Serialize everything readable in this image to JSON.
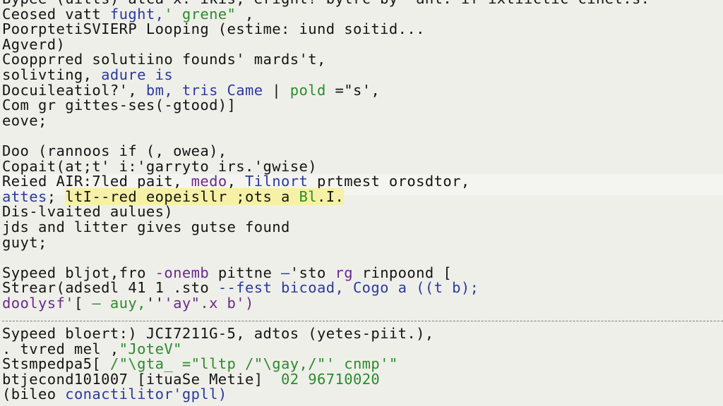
{
  "colors": {
    "text": "#141414",
    "blue": "#2b3a9c",
    "green": "#2a8c2a",
    "purple": "#6a2a8a",
    "highlight": "#f6f1a6"
  },
  "lines": [
    {
      "segs": [
        {
          "t": "Bypee (uitts) atca-x. ikis, eright? bytrc by  ant. if ixtiictic cinet.s.",
          "c": "text"
        }
      ]
    },
    {
      "segs": [
        {
          "t": "Ceosed vatt ",
          "c": "text"
        },
        {
          "t": "fught,",
          "c": "blue"
        },
        {
          "t": "' grene\"",
          "c": "green"
        },
        {
          "t": " ,",
          "c": "text"
        }
      ]
    },
    {
      "segs": [
        {
          "t": "PoorptetiSVIERP Looping (estime: iund soitid...",
          "c": "text"
        }
      ]
    },
    {
      "segs": [
        {
          "t": "Agverd)",
          "c": "text"
        }
      ]
    },
    {
      "segs": [
        {
          "t": "Coopprred solutiino founds' mards't,",
          "c": "text"
        }
      ]
    },
    {
      "segs": [
        {
          "t": "solivting, ",
          "c": "text"
        },
        {
          "t": "adure is",
          "c": "blue"
        }
      ]
    },
    {
      "segs": [
        {
          "t": "Docuileatiol?', ",
          "c": "text"
        },
        {
          "t": "bm, tris Came",
          "c": "blue"
        },
        {
          "t": " | ",
          "c": "text"
        },
        {
          "t": "pold",
          "c": "green"
        },
        {
          "t": " =\"s',",
          "c": "text"
        }
      ]
    },
    {
      "segs": [
        {
          "t": "Com gr gittes-ses(-gtood)]",
          "c": "text"
        }
      ]
    },
    {
      "segs": [
        {
          "t": "eove;",
          "c": "text"
        }
      ]
    },
    {
      "segs": []
    },
    {
      "segs": [
        {
          "t": "Doo (rannoos if (, owea),",
          "c": "text"
        }
      ]
    },
    {
      "segs": [
        {
          "t": "Copait(at;t' i:'garryto irs.'gwise)",
          "c": "text"
        }
      ]
    },
    {
      "segs": [
        {
          "t": "Reied AIR:7led pait, ",
          "c": "text"
        },
        {
          "t": "medo",
          "c": "purple"
        },
        {
          "t": ", ",
          "c": "text"
        },
        {
          "t": "Tilnort",
          "c": "blue"
        },
        {
          "t": " prtmest orosdtor,",
          "c": "text"
        }
      ]
    },
    {
      "highlight": true,
      "segs": [
        {
          "t": "attes",
          "c": "blue"
        },
        {
          "t": "; ",
          "c": "text"
        },
        {
          "t": "ltI--red eopeisllr ;ots a ",
          "c": "text",
          "hl": true
        },
        {
          "t": "Bl",
          "c": "green",
          "hl": true
        },
        {
          "t": ".I.",
          "c": "text",
          "hl": true
        }
      ]
    },
    {
      "segs": [
        {
          "t": "Dis-lvaited aulues)",
          "c": "text"
        }
      ]
    },
    {
      "segs": [
        {
          "t": "jds and litter gives gutse found",
          "c": "text"
        }
      ]
    },
    {
      "segs": [
        {
          "t": "guyt;",
          "c": "text"
        }
      ]
    },
    {
      "segs": []
    },
    {
      "segs": [
        {
          "t": "Sypeed bljot,fro ",
          "c": "text"
        },
        {
          "t": "-onemb",
          "c": "purple"
        },
        {
          "t": " pittne ",
          "c": "text"
        },
        {
          "t": "—",
          "c": "blue"
        },
        {
          "t": "'sto ",
          "c": "text"
        },
        {
          "t": "rg",
          "c": "purple"
        },
        {
          "t": " rinpoond [",
          "c": "text"
        }
      ]
    },
    {
      "segs": [
        {
          "t": "Strear(adsedl 41 1 .sto ",
          "c": "text"
        },
        {
          "t": "--fest bicoad, Cogo a ((t b);",
          "c": "blue"
        }
      ]
    },
    {
      "segs": [
        {
          "t": "doolysf'",
          "c": "purple"
        },
        {
          "t": "[ ",
          "c": "text"
        },
        {
          "t": "— auy,",
          "c": "green"
        },
        {
          "t": "''",
          "c": "text"
        },
        {
          "t": "'ay\".x b')",
          "c": "purple"
        }
      ]
    },
    {
      "separator": true,
      "segs": []
    },
    {
      "segs": [
        {
          "t": "Sypeed bloert:) JCI7211G-5, adtos (yetes-piit.),",
          "c": "text"
        }
      ]
    },
    {
      "segs": [
        {
          "t": ". tvred mel ,",
          "c": "text"
        },
        {
          "t": "\"JoteV\"",
          "c": "green"
        }
      ]
    },
    {
      "segs": [
        {
          "t": "Stsmpedpa5[ ",
          "c": "text"
        },
        {
          "t": "/\"\\gta_ =\"lltp /\"\\gay,/\"' cnmp'\"",
          "c": "green"
        }
      ]
    },
    {
      "segs": [
        {
          "t": "btjecond101007 [ituaSe Metie]  ",
          "c": "text"
        },
        {
          "t": "02 96710020",
          "c": "green"
        }
      ]
    },
    {
      "segs": [
        {
          "t": "(bileo ",
          "c": "text"
        },
        {
          "t": "conactilitor'gpll)",
          "c": "blue"
        }
      ]
    }
  ]
}
